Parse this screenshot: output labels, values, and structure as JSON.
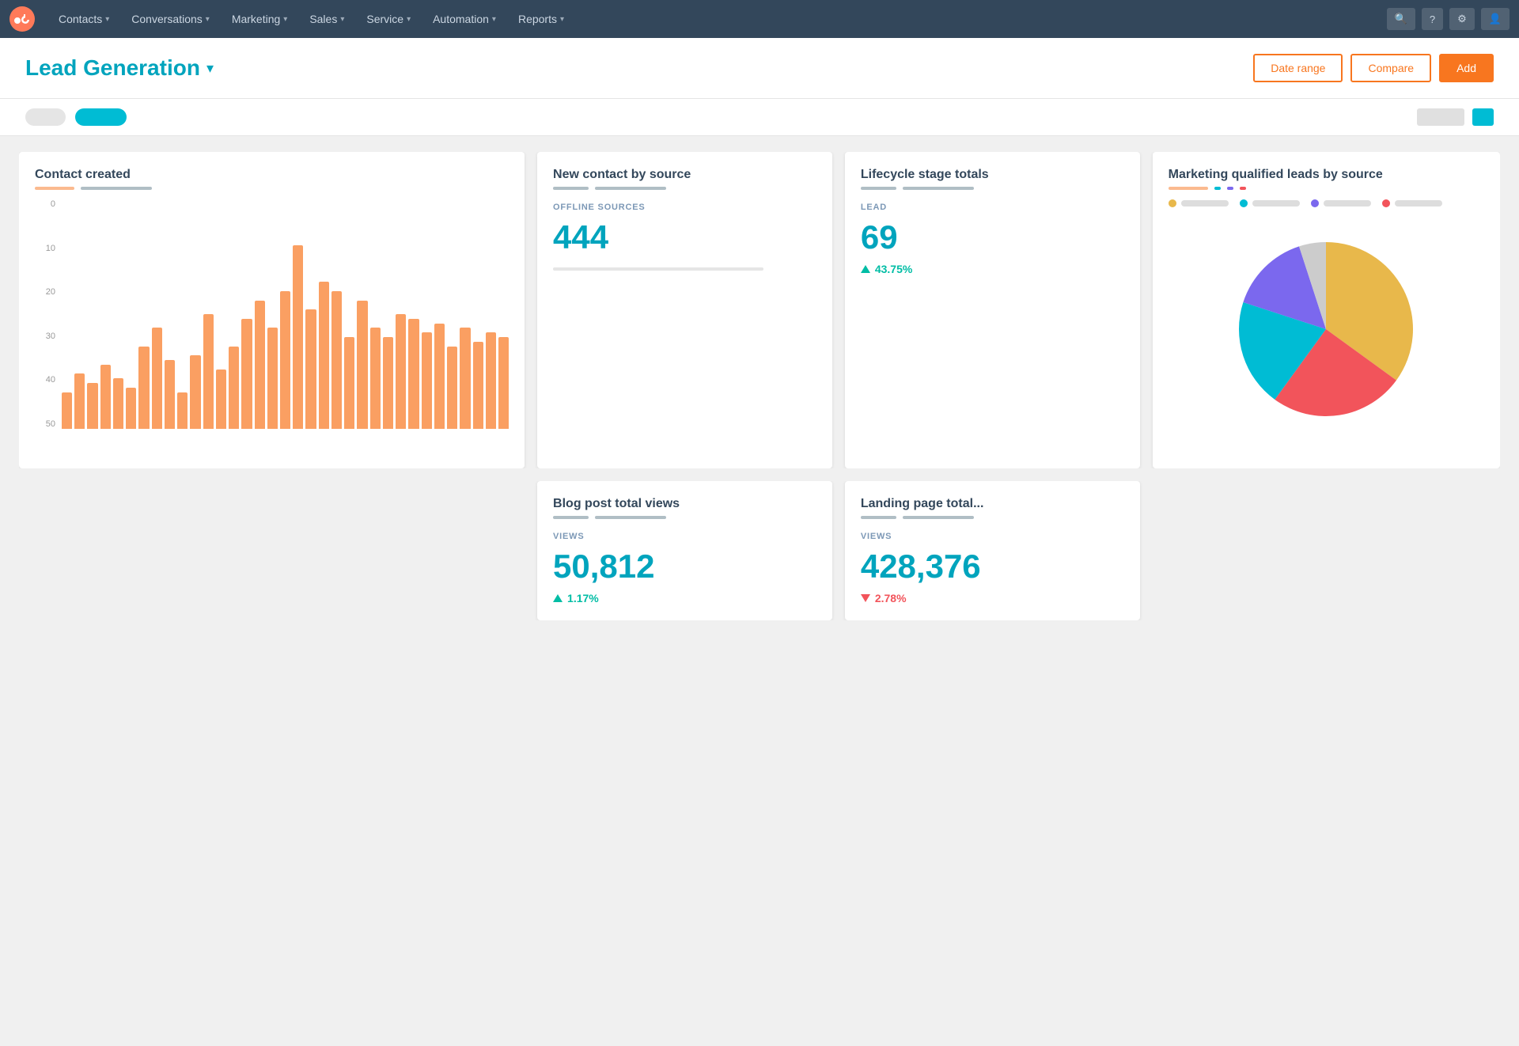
{
  "navbar": {
    "logo_alt": "HubSpot",
    "items": [
      {
        "label": "Contacts",
        "id": "contacts"
      },
      {
        "label": "Conversations",
        "id": "conversations"
      },
      {
        "label": "Marketing",
        "id": "marketing"
      },
      {
        "label": "Sales",
        "id": "sales"
      },
      {
        "label": "Service",
        "id": "service"
      },
      {
        "label": "Automation",
        "id": "automation"
      },
      {
        "label": "Reports",
        "id": "reports"
      }
    ],
    "right_btns": [
      "",
      "",
      "",
      ""
    ]
  },
  "header": {
    "title": "Lead Generation",
    "chevron": "▾",
    "btn1": "Date range",
    "btn2": "Compare",
    "btn3": "Add"
  },
  "filter_bar": {
    "pills": [
      {
        "label": "",
        "active": false
      },
      {
        "label": "",
        "active": true
      }
    ],
    "right_tags": [
      {
        "label": "",
        "teal": false
      },
      {
        "label": "",
        "teal": true
      }
    ]
  },
  "cards": {
    "contact_created": {
      "title": "Contact created",
      "y_labels": [
        "50",
        "40",
        "30",
        "20",
        "10",
        "0"
      ],
      "bars": [
        8,
        12,
        10,
        14,
        11,
        9,
        18,
        22,
        15,
        8,
        16,
        25,
        13,
        18,
        24,
        28,
        22,
        30,
        40,
        26,
        32,
        30,
        20,
        28,
        22,
        20,
        25,
        24,
        21,
        23,
        18,
        22,
        19,
        21,
        20
      ],
      "x_labels": [
        "",
        "",
        "",
        "",
        "",
        "",
        "",
        "",
        "",
        "",
        "",
        "",
        "",
        "",
        "",
        "",
        "",
        "",
        "",
        "",
        "",
        "",
        "",
        "",
        "",
        "",
        "",
        "",
        "",
        "",
        "",
        "",
        "",
        "",
        ""
      ]
    },
    "new_contact_by_source": {
      "title": "New contact by source",
      "metric_label": "OFFLINE SOURCES",
      "metric_value": "444"
    },
    "lifecycle_stage": {
      "title": "Lifecycle stage totals",
      "metric_label": "LEAD",
      "metric_value": "69",
      "change_pct": "43.75%",
      "change_dir": "up"
    },
    "marketing_qualified": {
      "title": "Marketing qualified leads by source",
      "legend": [
        {
          "color": "#e8b84b",
          "label": ""
        },
        {
          "color": "#00bcd4",
          "label": ""
        },
        {
          "color": "#7b68ee",
          "label": ""
        },
        {
          "color": "#f2545b",
          "label": ""
        }
      ],
      "pie_colors": [
        "#e8b84b",
        "#f2545b",
        "#00bcd4",
        "#7b68ee",
        "#ccc"
      ],
      "pie_values": [
        35,
        25,
        20,
        15,
        5
      ]
    },
    "blog_post": {
      "title": "Blog post total views",
      "metric_label": "VIEWS",
      "metric_value": "50,812",
      "change_pct": "1.17%",
      "change_dir": "up"
    },
    "landing_page": {
      "title": "Landing page total...",
      "metric_label": "VIEWS",
      "metric_value": "428,376",
      "change_pct": "2.78%",
      "change_dir": "down"
    }
  }
}
